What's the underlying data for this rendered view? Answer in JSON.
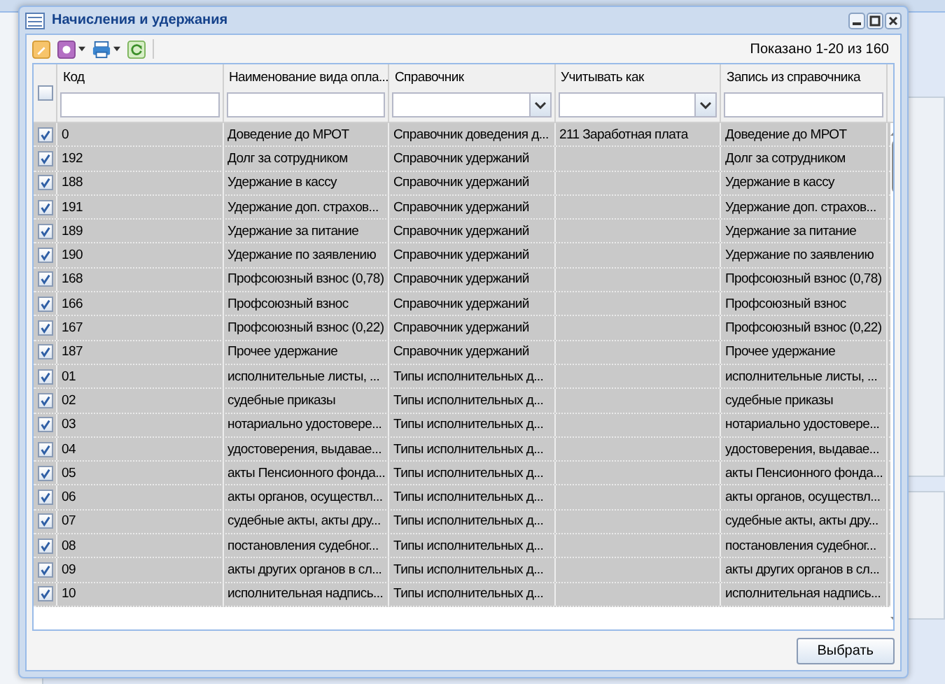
{
  "window": {
    "title": "Начисления и удержания"
  },
  "toolbar": {
    "paging": "Показано 1-20 из 160"
  },
  "table": {
    "all_checked": false,
    "columns": [
      {
        "label": "Код",
        "kind": "text"
      },
      {
        "label": "Наименование вида опла...",
        "kind": "text"
      },
      {
        "label": "Справочник",
        "kind": "combo"
      },
      {
        "label": "Учитывать как",
        "kind": "combo"
      },
      {
        "label": "Запись из справочника",
        "kind": "text"
      }
    ],
    "rows": [
      {
        "checked": true,
        "cells": [
          "0",
          "Доведение до МРОТ",
          "Справочник доведения д...",
          "211 Заработная плата",
          "Доведение до МРОТ"
        ]
      },
      {
        "checked": true,
        "cells": [
          "192",
          "Долг за сотрудником",
          "Справочник удержаний",
          "",
          "Долг за сотрудником"
        ]
      },
      {
        "checked": true,
        "cells": [
          "188",
          "Удержание в кассу",
          "Справочник удержаний",
          "",
          "Удержание в кассу"
        ]
      },
      {
        "checked": true,
        "cells": [
          "191",
          "Удержание доп. страхов...",
          "Справочник удержаний",
          "",
          "Удержание доп. страхов..."
        ]
      },
      {
        "checked": true,
        "cells": [
          "189",
          "Удержание за питание",
          "Справочник удержаний",
          "",
          "Удержание за питание"
        ]
      },
      {
        "checked": true,
        "cells": [
          "190",
          "Удержание по заявлению",
          "Справочник удержаний",
          "",
          "Удержание по заявлению"
        ]
      },
      {
        "checked": true,
        "cells": [
          "168",
          "Профсоюзный взнос (0,78)",
          "Справочник удержаний",
          "",
          "Профсоюзный взнос (0,78)"
        ]
      },
      {
        "checked": true,
        "cells": [
          "166",
          "Профсоюзный взнос",
          "Справочник удержаний",
          "",
          "Профсоюзный взнос"
        ]
      },
      {
        "checked": true,
        "cells": [
          "167",
          "Профсоюзный взнос (0,22)",
          "Справочник удержаний",
          "",
          "Профсоюзный взнос (0,22)"
        ]
      },
      {
        "checked": true,
        "cells": [
          "187",
          "Прочее удержание",
          "Справочник удержаний",
          "",
          "Прочее удержание"
        ]
      },
      {
        "checked": true,
        "cells": [
          "01",
          "исполнительные листы, ...",
          "Типы исполнительных д...",
          "",
          "исполнительные листы, ..."
        ]
      },
      {
        "checked": true,
        "cells": [
          "02",
          "судебные приказы",
          "Типы исполнительных д...",
          "",
          "судебные приказы"
        ]
      },
      {
        "checked": true,
        "cells": [
          "03",
          "нотариально удостовере...",
          "Типы исполнительных д...",
          "",
          "нотариально удостовере..."
        ]
      },
      {
        "checked": true,
        "cells": [
          "04",
          "удостоверения, выдавае...",
          "Типы исполнительных д...",
          "",
          "удостоверения, выдавае..."
        ]
      },
      {
        "checked": true,
        "cells": [
          "05",
          "акты Пенсионного фонда...",
          "Типы исполнительных д...",
          "",
          "акты Пенсионного фонда..."
        ]
      },
      {
        "checked": true,
        "cells": [
          "06",
          "акты органов, осуществл...",
          "Типы исполнительных д...",
          "",
          "акты органов, осуществл..."
        ]
      },
      {
        "checked": true,
        "cells": [
          "07",
          "судебные акты, акты дру...",
          "Типы исполнительных д...",
          "",
          "судебные акты, акты дру..."
        ]
      },
      {
        "checked": true,
        "cells": [
          "08",
          "постановления судебног...",
          "Типы исполнительных д...",
          "",
          "постановления судебног..."
        ]
      },
      {
        "checked": true,
        "cells": [
          "09",
          "акты других органов в сл...",
          "Типы исполнительных д...",
          "",
          "акты других органов в сл..."
        ]
      },
      {
        "checked": true,
        "cells": [
          "10",
          "исполнительная надпись...",
          "Типы исполнительных д...",
          "",
          "исполнительная надпись..."
        ]
      }
    ]
  },
  "buttons": [
    "Выбрать"
  ]
}
